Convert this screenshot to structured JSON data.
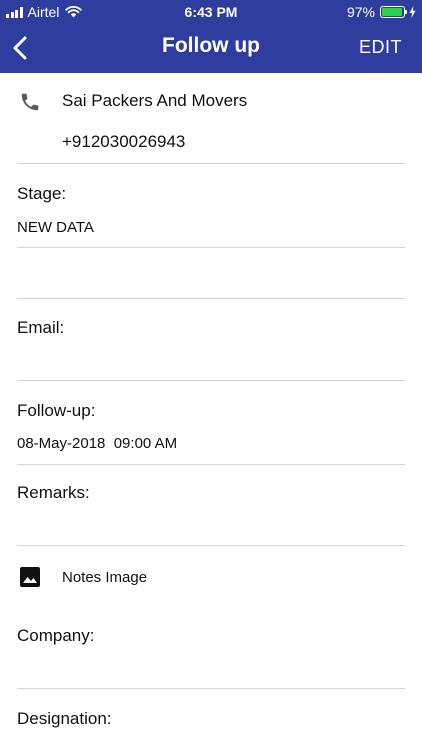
{
  "status_bar": {
    "carrier": "Airtel",
    "time": "6:43 PM",
    "battery": "97%",
    "battery_level": 0.97
  },
  "header": {
    "title": "Follow up",
    "edit_label": "EDIT",
    "back_icon": "chevron-left-icon"
  },
  "contact": {
    "name": "Sai Packers And Movers",
    "phone": "+912030026943",
    "icon": "phone-icon"
  },
  "fields": {
    "stage_label": "Stage:",
    "stage_value": "NEW DATA",
    "email_label": "Email:",
    "followup_label": "Follow-up:",
    "followup_value": "08-May-2018  09:00 AM",
    "remarks_label": "Remarks:",
    "notes_image_label": "Notes Image",
    "notes_image_icon": "image-icon",
    "company_label": "Company:",
    "designation_label": "Designation:"
  },
  "colors": {
    "header_bg": "#2f3d9e",
    "battery_fill": "#27d34a"
  }
}
